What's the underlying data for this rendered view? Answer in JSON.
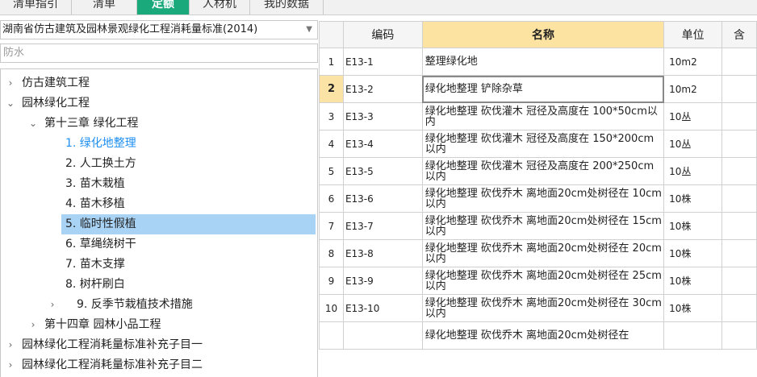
{
  "tabs": [
    "清单指引",
    "清单",
    "定额",
    "人材机",
    "我的数据"
  ],
  "active_tab": 2,
  "library_select": {
    "value": "湖南省仿古建筑及园林景观绿化工程消耗量标准(2014)"
  },
  "filter": {
    "value": "防水"
  },
  "tree": [
    {
      "label": "仿古建筑工程",
      "arrow": "›",
      "selected": false,
      "link": false
    },
    {
      "label": "园林绿化工程",
      "arrow": "⌄",
      "selected": false,
      "link": false
    },
    {
      "label": "第十三章 绿化工程",
      "arrow": "⌄",
      "selected": false,
      "link": false
    },
    {
      "label": "1. 绿化地整理",
      "arrow": "",
      "selected": false,
      "link": true
    },
    {
      "label": "2. 人工换土方",
      "arrow": "",
      "selected": false,
      "link": false
    },
    {
      "label": "3. 苗木栽植",
      "arrow": "",
      "selected": false,
      "link": false
    },
    {
      "label": "4. 苗木移植",
      "arrow": "",
      "selected": false,
      "link": false
    },
    {
      "label": "5. 临时性假植",
      "arrow": "",
      "selected": true,
      "link": false
    },
    {
      "label": "6. 草绳绕树干",
      "arrow": "",
      "selected": false,
      "link": false
    },
    {
      "label": "7. 苗木支撑",
      "arrow": "",
      "selected": false,
      "link": false
    },
    {
      "label": "8. 树杆刷白",
      "arrow": "",
      "selected": false,
      "link": false
    },
    {
      "label": "9. 反季节栽植技术措施",
      "arrow": "›",
      "selected": false,
      "link": false
    },
    {
      "label": "第十四章 园林小品工程",
      "arrow": "›",
      "selected": false,
      "link": false
    },
    {
      "label": "园林绿化工程消耗量标准补充子目一",
      "arrow": "›",
      "selected": false,
      "link": false
    },
    {
      "label": "园林绿化工程消耗量标准补充子目二",
      "arrow": "›",
      "selected": false,
      "link": false
    }
  ],
  "grid": {
    "headers": [
      "",
      "编码",
      "名称",
      "单位",
      "含"
    ],
    "current_row": 2,
    "rows": [
      {
        "no": "1",
        "code": "E13-1",
        "name": "整理绿化地",
        "unit": "10m2"
      },
      {
        "no": "2",
        "code": "E13-2",
        "name": "绿化地整理 铲除杂草",
        "unit": "10m2"
      },
      {
        "no": "3",
        "code": "E13-3",
        "name": "绿化地整理 砍伐灌木 冠径及高度在 100*50cm以内",
        "unit": "10丛"
      },
      {
        "no": "4",
        "code": "E13-4",
        "name": "绿化地整理 砍伐灌木 冠径及高度在 150*200cm以内",
        "unit": "10丛"
      },
      {
        "no": "5",
        "code": "E13-5",
        "name": "绿化地整理 砍伐灌木 冠径及高度在 200*250cm以内",
        "unit": "10丛"
      },
      {
        "no": "6",
        "code": "E13-6",
        "name": "绿化地整理 砍伐乔木 离地面20cm处树径在 10cm以内",
        "unit": "10株"
      },
      {
        "no": "7",
        "code": "E13-7",
        "name": "绿化地整理 砍伐乔木 离地面20cm处树径在 15cm以内",
        "unit": "10株"
      },
      {
        "no": "8",
        "code": "E13-8",
        "name": "绿化地整理 砍伐乔木 离地面20cm处树径在 20cm以内",
        "unit": "10株"
      },
      {
        "no": "9",
        "code": "E13-9",
        "name": "绿化地整理 砍伐乔木 离地面20cm处树径在 25cm以内",
        "unit": "10株"
      },
      {
        "no": "10",
        "code": "E13-10",
        "name": "绿化地整理 砍伐乔木 离地面20cm处树径在 30cm以内",
        "unit": "10株"
      },
      {
        "no": "",
        "code": "",
        "name": "绿化地整理 砍伐乔木 离地面20cm处树径在",
        "unit": ""
      }
    ]
  }
}
